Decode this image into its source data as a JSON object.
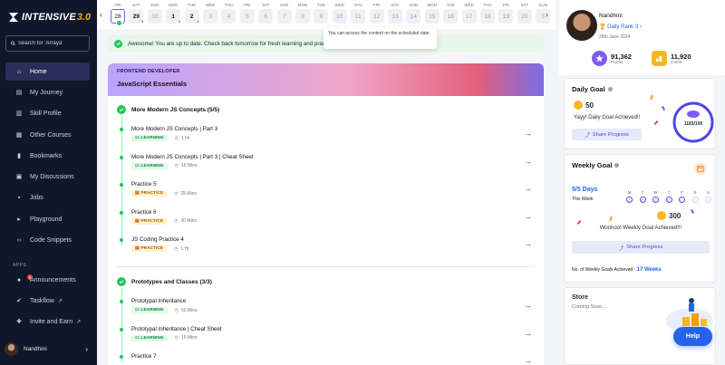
{
  "brand": {
    "name": "INTENSIVE",
    "version": "3.0"
  },
  "sidebar": {
    "search_placeholder": "Search for 'Arraya'",
    "items": [
      {
        "label": "Home",
        "icon": "home-icon"
      },
      {
        "label": "My Journey",
        "icon": "journey-icon"
      },
      {
        "label": "Skill Profile",
        "icon": "chart-icon"
      },
      {
        "label": "Other Courses",
        "icon": "courses-icon"
      },
      {
        "label": "Bookmarks",
        "icon": "bookmark-icon"
      },
      {
        "label": "My Discussions",
        "icon": "chat-icon"
      },
      {
        "label": "Jobs",
        "icon": "briefcase-icon"
      },
      {
        "label": "Playground",
        "icon": "terminal-icon"
      },
      {
        "label": "Code Snippets",
        "icon": "code-icon"
      }
    ],
    "apps_label": "APPS",
    "apps": [
      {
        "label": "Announcements",
        "icon": "announcement-icon",
        "badge": "5"
      },
      {
        "label": "Taskflow",
        "icon": "taskflow-icon"
      },
      {
        "label": "Invite and Earn",
        "icon": "gift-icon"
      }
    ],
    "user": "Nandhini"
  },
  "dates": [
    {
      "d": "FRI",
      "n": "28",
      "sub": "",
      "cur": true
    },
    {
      "d": "SAT",
      "n": "29",
      "sub": "3",
      "dark": true
    },
    {
      "d": "SUN",
      "n": "30",
      "sub": ""
    },
    {
      "d": "MON",
      "n": "1",
      "sub": "2",
      "dark": true
    },
    {
      "d": "TUE",
      "n": "2",
      "sub": "2",
      "dark": true
    },
    {
      "d": "WED",
      "n": "3",
      "sub": ""
    },
    {
      "d": "THU",
      "n": "4",
      "sub": ""
    },
    {
      "d": "FRI",
      "n": "5",
      "sub": ""
    },
    {
      "d": "SAT",
      "n": "6",
      "sub": ""
    },
    {
      "d": "SUN",
      "n": "7",
      "sub": ""
    },
    {
      "d": "MON",
      "n": "8",
      "sub": ""
    },
    {
      "d": "TUE",
      "n": "9",
      "sub": ""
    },
    {
      "d": "WED",
      "n": "10",
      "sub": ""
    },
    {
      "d": "THU",
      "n": "11",
      "sub": ""
    },
    {
      "d": "FRI",
      "n": "12",
      "sub": ""
    },
    {
      "d": "SAT",
      "n": "13",
      "sub": ""
    },
    {
      "d": "SUN",
      "n": "14",
      "sub": ""
    },
    {
      "d": "MON",
      "n": "15",
      "sub": ""
    },
    {
      "d": "TUE",
      "n": "16",
      "sub": ""
    },
    {
      "d": "WED",
      "n": "17",
      "sub": ""
    },
    {
      "d": "THU",
      "n": "18",
      "sub": ""
    },
    {
      "d": "FRI",
      "n": "19",
      "sub": ""
    },
    {
      "d": "SAT",
      "n": "20",
      "sub": ""
    },
    {
      "d": "SUN",
      "n": "3",
      "sub": ""
    }
  ],
  "tooltip": "You can access the content on the scheduled date",
  "alert": "Awesome! You are up to date. Check back tomorrow for fresh learning and practice.",
  "course": {
    "tag": "FRONTEND DEVELOPER",
    "title": "JavaScript Essentials",
    "modules": [
      {
        "title": "More Modern JS Concepts (5/5)",
        "lessons": [
          {
            "name": "More Modern JS Concepts | Part 3",
            "type": "LEARNING",
            "dur": "1 Hr"
          },
          {
            "name": "More Modern JS Concepts | Part 3 | Cheat Sheet",
            "type": "LEARNING",
            "dur": "15 Mins"
          },
          {
            "name": "Practice 5",
            "type": "PRACTICE",
            "dur": "25 Mins"
          },
          {
            "name": "Practice 6",
            "type": "PRACTICE",
            "dur": "30 Mins"
          },
          {
            "name": "JS Coding Practice 4",
            "type": "PRACTICE",
            "dur": "1 Hr"
          }
        ]
      },
      {
        "title": "Prototypes and Classes (3/3)",
        "lessons": [
          {
            "name": "Prototypal Inheritance",
            "type": "LEARNING",
            "dur": "50 Mins"
          },
          {
            "name": "Prototypal Inheritance | Cheat Sheet",
            "type": "LEARNING",
            "dur": "15 Mins"
          },
          {
            "name": "Practice 7",
            "type": "",
            "dur": ""
          }
        ]
      }
    ]
  },
  "profile": {
    "name": "Nandhini",
    "rank": "Daily Rank 3",
    "date": "28th June 2024",
    "points": "91,362",
    "points_label": "Points",
    "coins": "11,920",
    "coins_label": "Coins"
  },
  "daily_goal": {
    "title": "Daily Goal",
    "coins": "50",
    "msg": "Yayy! Daily Goal Achieved!!",
    "share": "Share Progress",
    "progress": "1183/100",
    "progress_fraction": 1
  },
  "weekly_goal": {
    "title": "Weekly Goal",
    "days": "5/5 Days",
    "this_week": "This Week",
    "week_days": [
      "M",
      "T",
      "W",
      "T",
      "F",
      "S",
      "S"
    ],
    "done": [
      true,
      true,
      true,
      true,
      true,
      false,
      false
    ],
    "coins": "300",
    "msg": "Woohoo! Weekly Goal Achieved!!!",
    "share": "Share Progress",
    "achieved_label": "No. of Weekly Goals Achieved - ",
    "achieved_value": "17 Weeks"
  },
  "store": {
    "title": "Store",
    "sub": "Coming Soon..."
  },
  "help": "Help",
  "colors": {
    "sidebar": "#0f1729",
    "accent": "#4f46e5",
    "success": "#22c55e",
    "help": "#2563eb"
  }
}
